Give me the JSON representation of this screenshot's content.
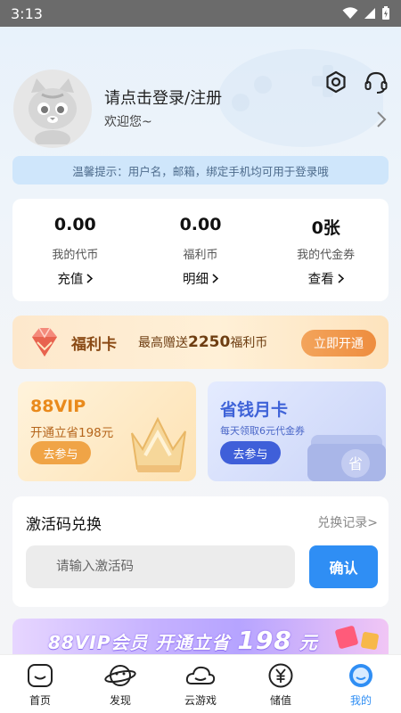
{
  "status_bar": {
    "time": "3:13"
  },
  "profile": {
    "login_prompt": "请点击登录/注册",
    "welcome": "欢迎您~"
  },
  "tip": "温馨提示：用户名，邮箱，绑定手机均可用于登录哦",
  "wallet": [
    {
      "value": "0.00",
      "label": "我的代币",
      "action": "充值"
    },
    {
      "value": "0.00",
      "label": "福利币",
      "action": "明细"
    },
    {
      "value": "0张",
      "label": "我的代金券",
      "action": "查看"
    }
  ],
  "fuli_card": {
    "title": "福利卡",
    "desc_prefix": "最高赠送",
    "amount": "2250",
    "desc_suffix": "福利币",
    "button": "立即开通"
  },
  "vip_card": {
    "title": "88VIP",
    "subtitle": "开通立省198元",
    "button": "去参与"
  },
  "month_card": {
    "title": "省钱月卡",
    "subtitle": "每天领取6元代金券",
    "button": "去参与"
  },
  "redeem": {
    "title": "激活码兑换",
    "record": "兑换记录>",
    "placeholder": "请输入激活码",
    "confirm": "确认"
  },
  "banner": {
    "text": "88VIP会员 开通立省",
    "amount": "198",
    "unit": "元"
  },
  "tabs": [
    {
      "label": "首页",
      "icon": "home-icon"
    },
    {
      "label": "发现",
      "icon": "planet-icon"
    },
    {
      "label": "云游戏",
      "icon": "cloud-icon"
    },
    {
      "label": "储值",
      "icon": "yuan-icon"
    },
    {
      "label": "我的",
      "icon": "profile-icon"
    }
  ],
  "colors": {
    "accent": "#2f8ef4",
    "tip_bg": "#cfe6fb",
    "fuli_button": "#ee8d3f",
    "vip_title": "#e98a1c",
    "month_title": "#3f63d8"
  }
}
